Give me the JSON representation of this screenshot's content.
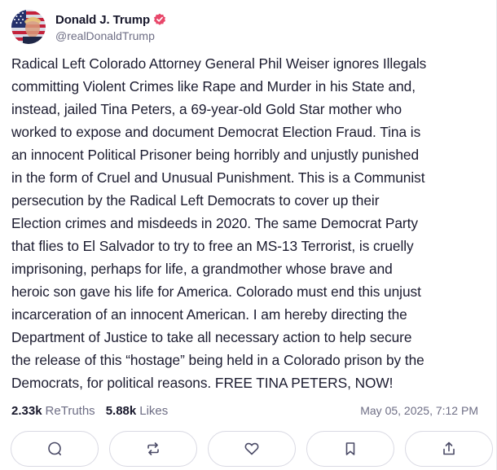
{
  "author": {
    "display_name": "Donald J. Trump",
    "handle": "@realDonaldTrump",
    "verified": true,
    "avatar_icon": "flag-portrait-avatar"
  },
  "post": {
    "text": "Radical Left Colorado Attorney General Phil Weiser ignores Illegals\ncommitting Violent Crimes like Rape and Murder in his State and,\ninstead, jailed Tina Peters, a 69-year-old Gold Star mother who\nworked to expose and document Democrat Election Fraud. Tina is\nan innocent Political Prisoner being horribly and unjustly punished\nin the form of Cruel and Unusual Punishment. This is a Communist\npersecution by the Radical Left Democrats to cover up their\nElection crimes and misdeeds in 2020. The same Democrat Party\nthat flies to El Salvador to try to free an MS-13 Terrorist, is cruelly\nimprisoning, perhaps for life, a grandmother whose brave and\nheroic son gave his life for America. Colorado must end this unjust\nincarceration of an innocent American. I am hereby directing the\nDepartment of Justice to take all necessary action to help secure\nthe release of this “hostage” being held in a Colorado prison by the\nDemocrats, for political reasons. FREE TINA PETERS, NOW!"
  },
  "stats": {
    "retruths_count": "2.33k",
    "retruths_label": "ReTruths",
    "likes_count": "5.88k",
    "likes_label": "Likes",
    "timestamp": "May 05, 2025, 7:12 PM"
  },
  "actions": [
    {
      "name": "reply",
      "icon": "speech-bubble-icon"
    },
    {
      "name": "retruth",
      "icon": "repost-arrows-icon"
    },
    {
      "name": "like",
      "icon": "heart-icon"
    },
    {
      "name": "bookmark",
      "icon": "bookmark-icon"
    },
    {
      "name": "share",
      "icon": "share-icon"
    }
  ],
  "colors": {
    "verified_badge": "#e8476a",
    "text_primary": "#1b1b2f",
    "text_secondary": "#6e6e85",
    "button_border": "#d9d9e3"
  }
}
